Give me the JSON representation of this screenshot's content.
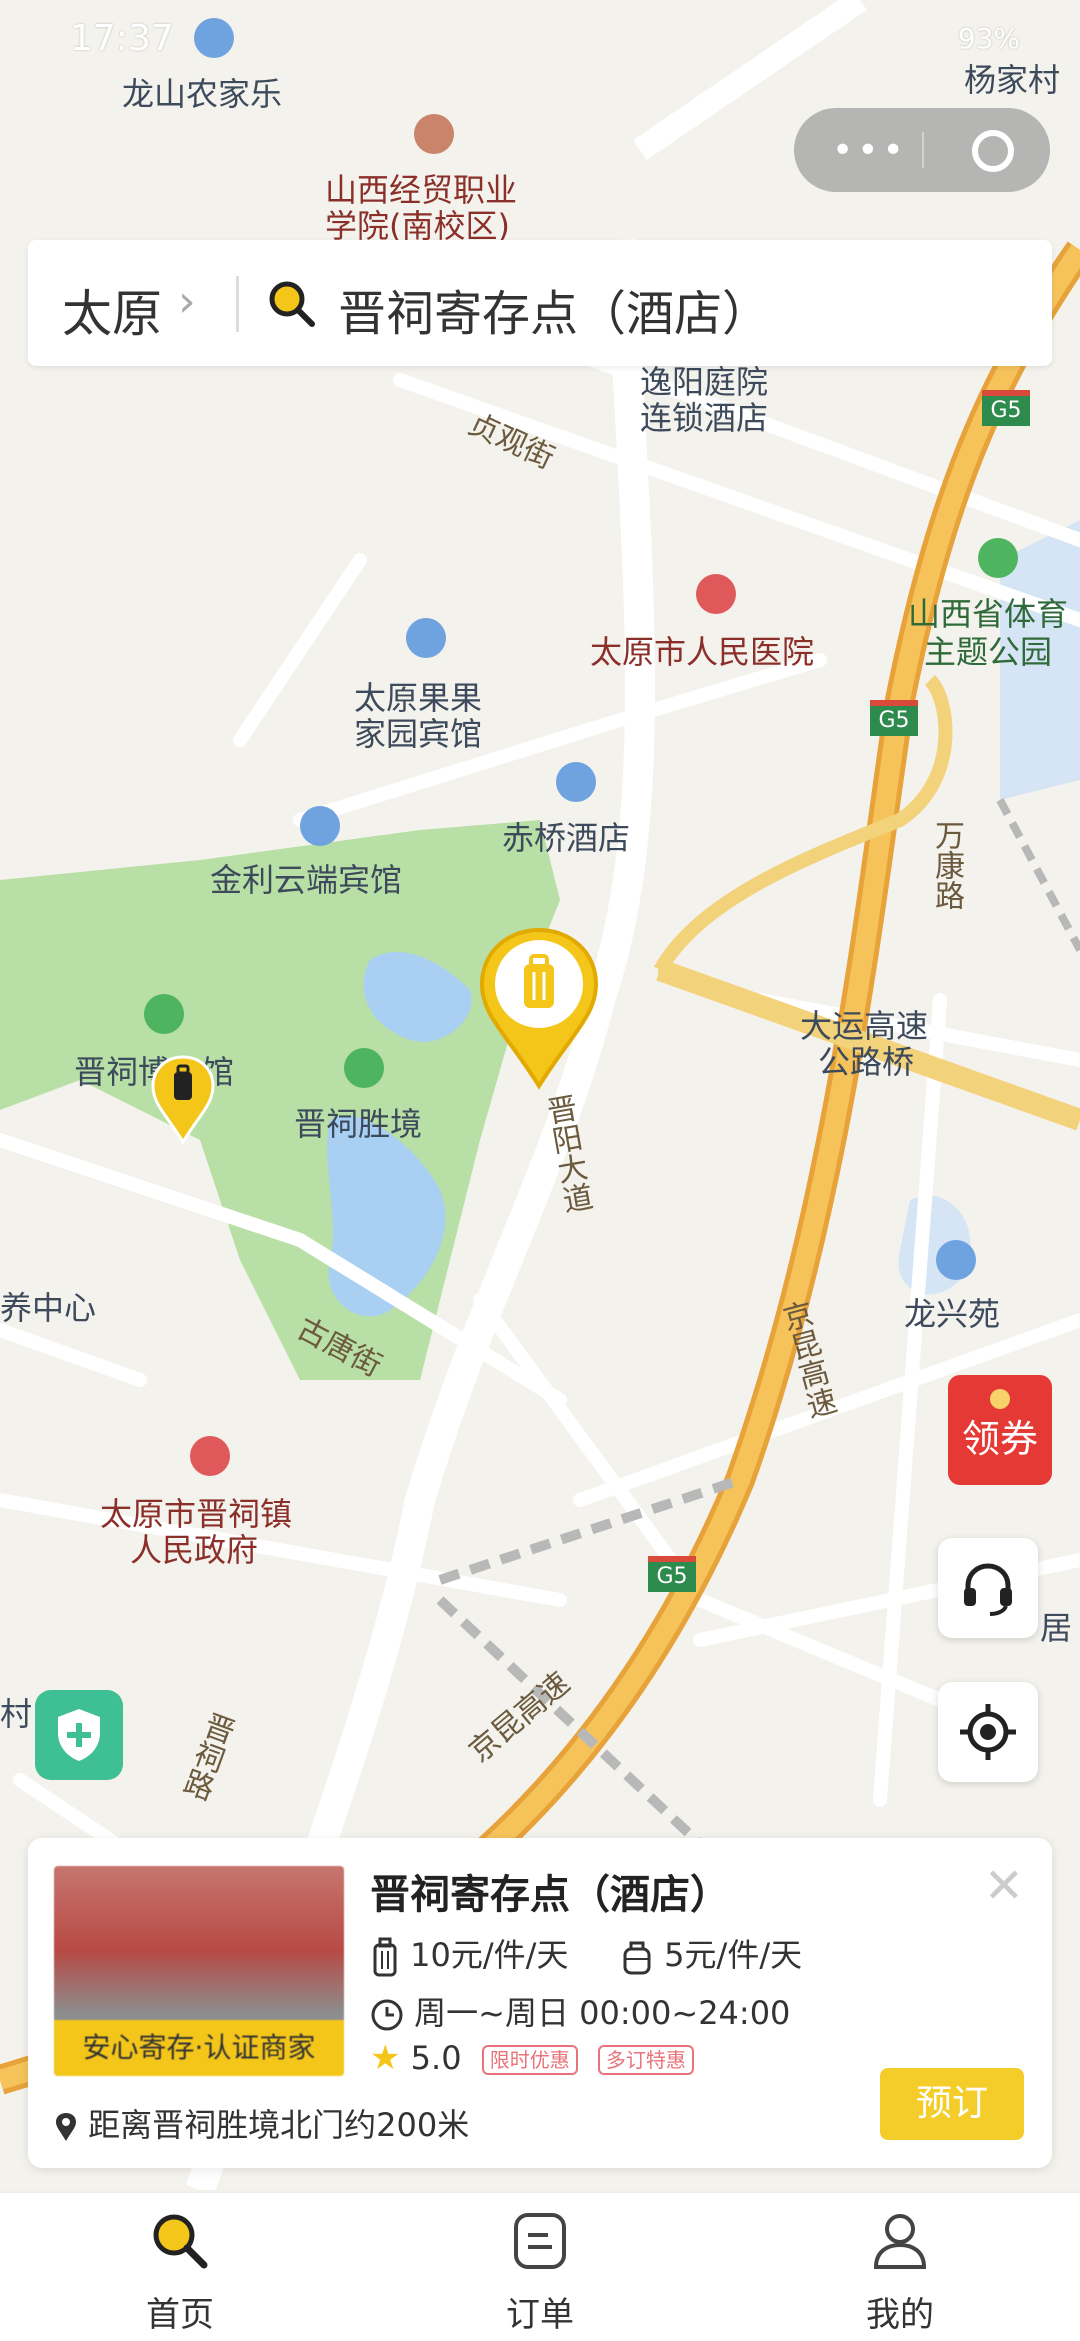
{
  "status_bar": {
    "time": "17:37",
    "battery": "93%"
  },
  "search": {
    "city": "太原",
    "chevron": "›",
    "query": "晋祠寄存点（酒店）"
  },
  "map_labels": [
    {
      "text": "杨家村",
      "cls": ""
    },
    {
      "text": "龙山农家乐",
      "cls": ""
    },
    {
      "text": "山西经贸职业",
      "cls": "red"
    },
    {
      "text": "学院(南校区)",
      "cls": "red"
    },
    {
      "text": "逸阳庭院",
      "cls": ""
    },
    {
      "text": "连锁酒店",
      "cls": ""
    },
    {
      "text": "贞观街",
      "cls": "road"
    },
    {
      "text": "太原市人民医院",
      "cls": "red"
    },
    {
      "text": "山西省体育",
      "cls": "grn"
    },
    {
      "text": "主题公园",
      "cls": "grn"
    },
    {
      "text": "太原果果",
      "cls": ""
    },
    {
      "text": "家园宾馆",
      "cls": ""
    },
    {
      "text": "赤桥酒店",
      "cls": ""
    },
    {
      "text": "金利云端宾馆",
      "cls": ""
    },
    {
      "text": "万康路",
      "cls": "road"
    },
    {
      "text": "晋祠博物馆",
      "cls": ""
    },
    {
      "text": "晋祠胜境",
      "cls": ""
    },
    {
      "text": "大运高速",
      "cls": ""
    },
    {
      "text": "公路桥",
      "cls": ""
    },
    {
      "text": "晋阳大道",
      "cls": "road"
    },
    {
      "text": "养中心",
      "cls": ""
    },
    {
      "text": "龙兴苑",
      "cls": ""
    },
    {
      "text": "京昆高速",
      "cls": "road"
    },
    {
      "text": "古唐街",
      "cls": "road"
    },
    {
      "text": "太原市晋祠镇",
      "cls": "red"
    },
    {
      "text": "人民政府",
      "cls": "red"
    },
    {
      "text": "京昆高速",
      "cls": "road"
    },
    {
      "text": "晋祠路",
      "cls": "road"
    },
    {
      "text": "村",
      "cls": ""
    },
    {
      "text": "居",
      "cls": ""
    }
  ],
  "highway_shields": [
    "G5",
    "G5",
    "G5"
  ],
  "coupon": {
    "label": "领券"
  },
  "card": {
    "thumb_ribbon": "安心寄存·认证商家",
    "title": "晋祠寄存点（酒店）",
    "price_large": "10元/件/天",
    "price_small": "5元/件/天",
    "hours": "周一~周日 00:00~24:00",
    "rating": "5.0",
    "tags": [
      "限时优惠",
      "多订特惠"
    ],
    "book_label": "预订",
    "distance": "距离晋祠胜境北门约200米"
  },
  "tabs": [
    {
      "label": "首页",
      "icon": "search-icon"
    },
    {
      "label": "订单",
      "icon": "order-icon"
    },
    {
      "label": "我的",
      "icon": "user-icon"
    }
  ],
  "colors": {
    "accent": "#F4C61A",
    "book": "#F4CD2A",
    "coupon": "#E53935",
    "shield": "#3FBF94"
  }
}
